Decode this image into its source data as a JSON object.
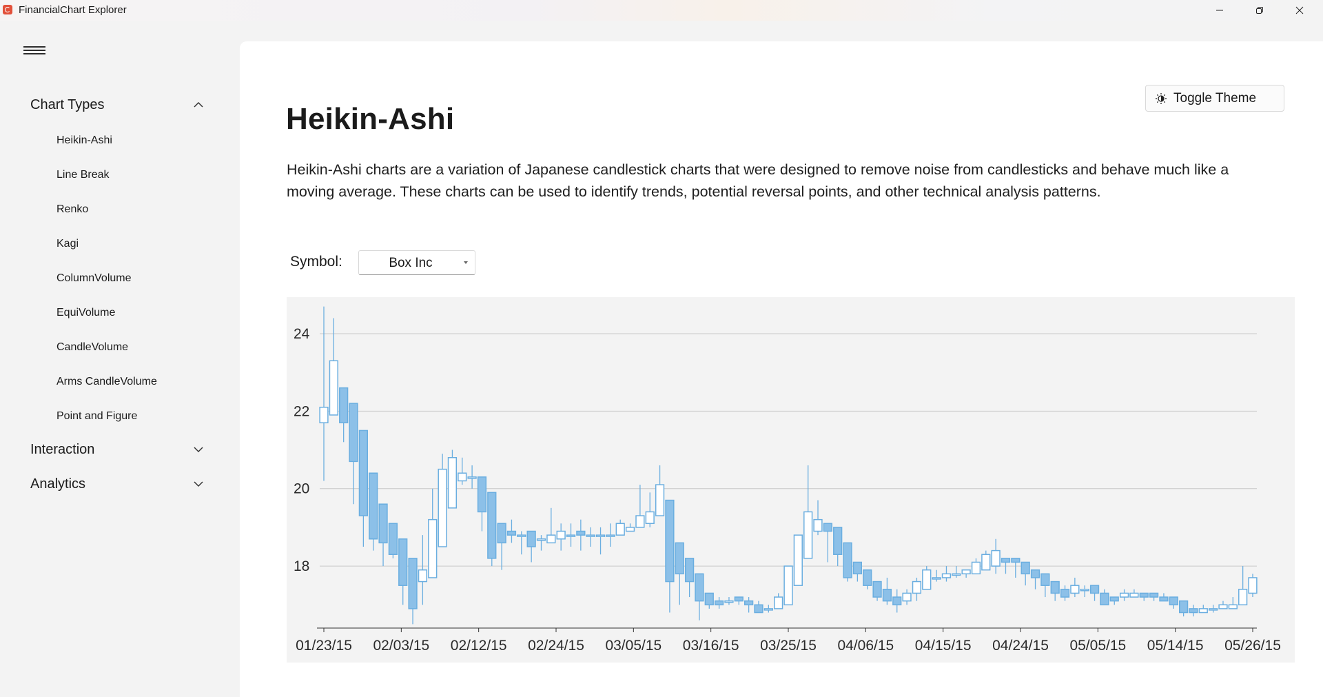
{
  "window": {
    "title": "FinancialChart Explorer"
  },
  "sidebar": {
    "groups": [
      {
        "label": "Chart Types",
        "expanded": true
      },
      {
        "label": "Interaction",
        "expanded": false
      },
      {
        "label": "Analytics",
        "expanded": false
      }
    ],
    "items": [
      {
        "label": "Heikin-Ashi"
      },
      {
        "label": "Line Break"
      },
      {
        "label": "Renko"
      },
      {
        "label": "Kagi"
      },
      {
        "label": "ColumnVolume"
      },
      {
        "label": "EquiVolume"
      },
      {
        "label": "CandleVolume"
      },
      {
        "label": "Arms CandleVolume"
      },
      {
        "label": "Point and Figure"
      }
    ]
  },
  "main": {
    "title": "Heikin-Ashi",
    "description": "Heikin-Ashi charts are a variation of Japanese candlestick charts that were designed to remove noise from candlesticks and behave much like a moving average. These charts can be used to identify trends, potential reversal points, and other technical analysis patterns.",
    "toggle_theme_label": "Toggle Theme",
    "symbol_label": "Symbol:",
    "symbol_value": "Box Inc"
  },
  "colors": {
    "candle": "#8cc0e8",
    "candle_stroke": "#6aaee0",
    "gridline": "#c8c8c8"
  },
  "icons": [
    "hamburger-menu-icon",
    "chevron-up-icon",
    "chevron-down-icon",
    "theme-toggle-icon",
    "dropdown-caret-icon"
  ],
  "chart_data": {
    "type": "candlestick",
    "subtype": "heikin-ashi",
    "title": "",
    "xlabel": "",
    "ylabel": "",
    "ylim": [
      16.4,
      24.8
    ],
    "yticks": [
      18,
      20,
      22,
      24
    ],
    "grid": true,
    "x_tick_labels": [
      "01/23/15",
      "02/03/15",
      "02/12/15",
      "02/24/15",
      "03/05/15",
      "03/16/15",
      "03/25/15",
      "04/06/15",
      "04/15/15",
      "04/24/15",
      "05/05/15",
      "05/14/15",
      "05/26/15"
    ],
    "candles": [
      [
        21.7,
        22.1,
        24.7,
        20.2
      ],
      [
        21.9,
        23.3,
        24.4,
        21.9
      ],
      [
        22.6,
        21.7,
        22.6,
        21.2
      ],
      [
        22.2,
        20.7,
        22.2,
        19.6
      ],
      [
        21.5,
        19.3,
        21.5,
        18.5
      ],
      [
        20.4,
        18.7,
        20.4,
        18.4
      ],
      [
        19.6,
        18.6,
        19.6,
        18.0
      ],
      [
        19.1,
        18.3,
        19.1,
        18.2
      ],
      [
        18.7,
        17.5,
        18.7,
        17.0
      ],
      [
        18.2,
        16.9,
        18.2,
        16.5
      ],
      [
        17.6,
        17.9,
        18.8,
        17.0
      ],
      [
        17.7,
        19.2,
        20.0,
        17.7
      ],
      [
        18.5,
        20.5,
        20.9,
        18.5
      ],
      [
        19.5,
        20.8,
        21.0,
        19.5
      ],
      [
        20.2,
        20.4,
        20.8,
        20.1
      ],
      [
        20.3,
        20.3,
        20.6,
        20.0
      ],
      [
        20.3,
        19.4,
        20.3,
        18.9
      ],
      [
        19.9,
        18.2,
        19.9,
        18.0
      ],
      [
        19.1,
        18.6,
        19.1,
        17.9
      ],
      [
        18.9,
        18.8,
        19.2,
        18.6
      ],
      [
        18.8,
        18.8,
        18.9,
        18.3
      ],
      [
        18.9,
        18.5,
        18.9,
        18.1
      ],
      [
        18.7,
        18.7,
        18.8,
        18.4
      ],
      [
        18.6,
        18.8,
        19.5,
        18.6
      ],
      [
        18.7,
        18.9,
        19.1,
        18.4
      ],
      [
        18.8,
        18.8,
        19.1,
        18.5
      ],
      [
        18.9,
        18.8,
        19.2,
        18.4
      ],
      [
        18.8,
        18.8,
        19.0,
        18.5
      ],
      [
        18.8,
        18.8,
        19.0,
        18.3
      ],
      [
        18.8,
        18.8,
        19.1,
        18.5
      ],
      [
        18.8,
        19.1,
        19.2,
        18.8
      ],
      [
        18.9,
        19.0,
        19.1,
        18.9
      ],
      [
        19.0,
        19.3,
        20.1,
        19.0
      ],
      [
        19.1,
        19.4,
        19.9,
        19.0
      ],
      [
        19.3,
        20.1,
        20.6,
        19.3
      ],
      [
        19.7,
        17.6,
        19.7,
        16.8
      ],
      [
        18.6,
        17.8,
        18.6,
        17.0
      ],
      [
        18.2,
        17.6,
        18.2,
        17.2
      ],
      [
        17.8,
        17.1,
        17.8,
        16.6
      ],
      [
        17.3,
        17.0,
        17.3,
        16.9
      ],
      [
        17.1,
        17.0,
        17.2,
        16.9
      ],
      [
        17.1,
        17.1,
        17.2,
        17.0
      ],
      [
        17.2,
        17.1,
        17.2,
        17.0
      ],
      [
        17.1,
        17.0,
        17.2,
        16.8
      ],
      [
        17.0,
        16.8,
        17.1,
        16.8
      ],
      [
        16.9,
        16.9,
        17.0,
        16.8
      ],
      [
        16.9,
        17.2,
        17.3,
        16.9
      ],
      [
        17.0,
        18.0,
        18.0,
        17.0
      ],
      [
        17.5,
        18.8,
        18.8,
        17.5
      ],
      [
        18.2,
        19.4,
        20.6,
        18.2
      ],
      [
        18.9,
        19.2,
        19.7,
        18.8
      ],
      [
        19.1,
        18.9,
        19.1,
        18.1
      ],
      [
        19.0,
        18.3,
        19.0,
        18.0
      ],
      [
        18.6,
        17.7,
        18.6,
        17.6
      ],
      [
        18.1,
        17.8,
        18.1,
        17.6
      ],
      [
        17.9,
        17.5,
        17.9,
        17.4
      ],
      [
        17.6,
        17.2,
        17.6,
        17.1
      ],
      [
        17.4,
        17.1,
        17.7,
        17.0
      ],
      [
        17.2,
        17.0,
        17.4,
        16.8
      ],
      [
        17.1,
        17.3,
        17.4,
        17.0
      ],
      [
        17.3,
        17.6,
        17.7,
        17.1
      ],
      [
        17.4,
        17.9,
        18.0,
        17.4
      ],
      [
        17.7,
        17.7,
        17.9,
        17.6
      ],
      [
        17.7,
        17.8,
        18.0,
        17.6
      ],
      [
        17.8,
        17.8,
        18.0,
        17.7
      ],
      [
        17.8,
        17.9,
        17.9,
        17.7
      ],
      [
        17.8,
        18.1,
        18.2,
        17.8
      ],
      [
        17.9,
        18.3,
        18.4,
        17.9
      ],
      [
        18.0,
        18.4,
        18.7,
        17.8
      ],
      [
        18.2,
        18.1,
        18.2,
        17.8
      ],
      [
        18.2,
        18.1,
        18.2,
        17.7
      ],
      [
        18.1,
        17.8,
        18.1,
        17.5
      ],
      [
        17.9,
        17.7,
        17.9,
        17.4
      ],
      [
        17.8,
        17.5,
        17.8,
        17.2
      ],
      [
        17.6,
        17.3,
        17.6,
        17.1
      ],
      [
        17.4,
        17.2,
        17.5,
        17.1
      ],
      [
        17.3,
        17.5,
        17.7,
        17.2
      ],
      [
        17.4,
        17.4,
        17.5,
        17.2
      ],
      [
        17.5,
        17.3,
        17.5,
        17.1
      ],
      [
        17.3,
        17.0,
        17.4,
        17.0
      ],
      [
        17.2,
        17.1,
        17.2,
        17.0
      ],
      [
        17.2,
        17.3,
        17.4,
        17.1
      ],
      [
        17.2,
        17.3,
        17.4,
        17.2
      ],
      [
        17.3,
        17.2,
        17.3,
        17.1
      ],
      [
        17.3,
        17.2,
        17.3,
        17.1
      ],
      [
        17.2,
        17.1,
        17.3,
        17.1
      ],
      [
        17.2,
        17.0,
        17.2,
        16.9
      ],
      [
        17.1,
        16.8,
        17.1,
        16.7
      ],
      [
        16.9,
        16.8,
        17.0,
        16.7
      ],
      [
        16.8,
        16.9,
        17.0,
        16.8
      ],
      [
        16.9,
        16.9,
        17.0,
        16.8
      ],
      [
        16.9,
        17.0,
        17.1,
        16.9
      ],
      [
        16.9,
        17.0,
        17.2,
        16.9
      ],
      [
        17.0,
        17.4,
        18.0,
        17.0
      ],
      [
        17.3,
        17.7,
        17.8,
        17.2
      ]
    ]
  }
}
